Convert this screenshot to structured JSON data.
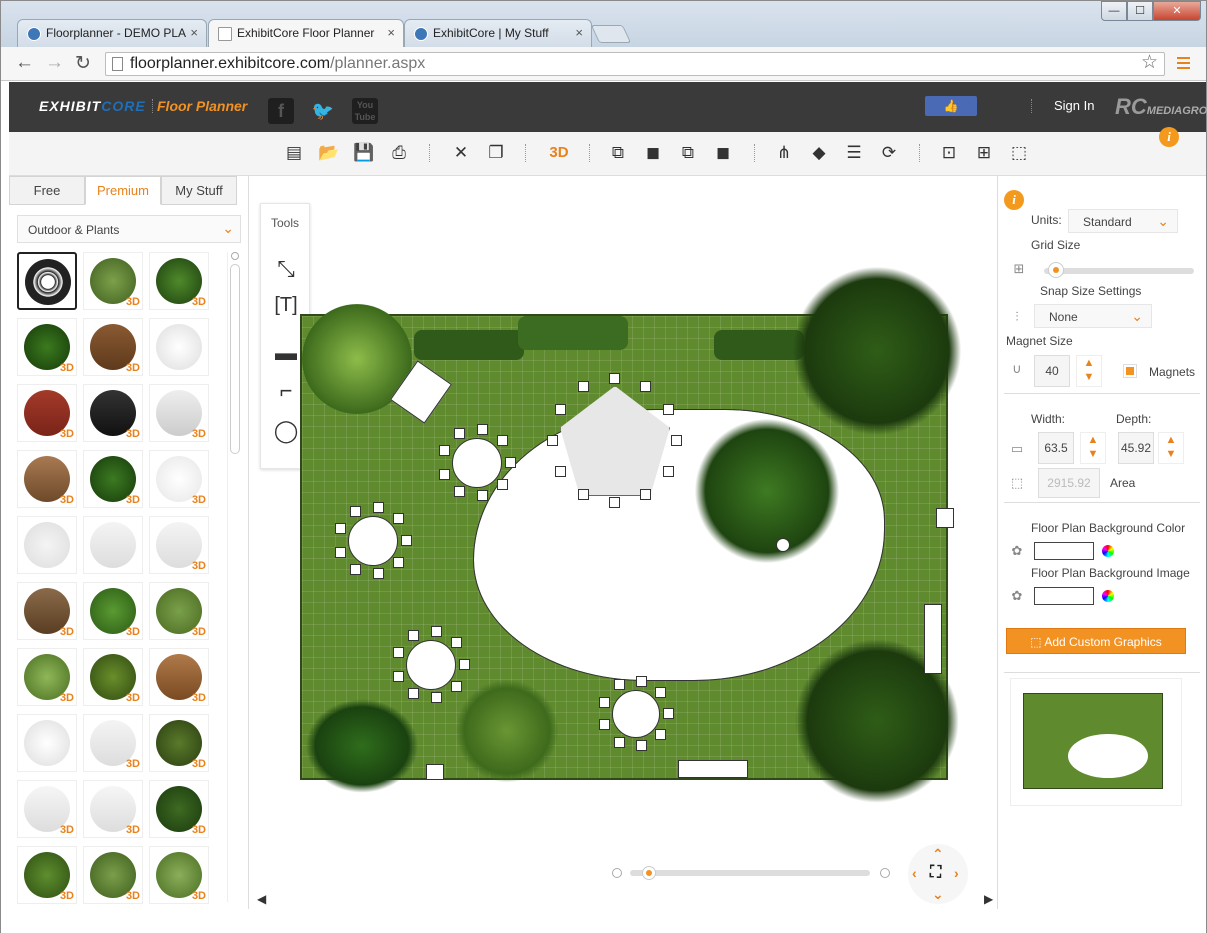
{
  "browser": {
    "tabs": [
      {
        "label": "Floorplanner - DEMO PLA",
        "close": "×"
      },
      {
        "label": "ExhibitCore Floor Planner",
        "close": "×"
      },
      {
        "label": "ExhibitCore | My Stuff",
        "close": "×"
      }
    ],
    "url_host": "floorplanner.exhibitcore.com",
    "url_path": "/planner.aspx",
    "window_controls": [
      "—",
      "☐",
      "✕"
    ]
  },
  "header": {
    "logo_exhibit": "EXHIBIT",
    "logo_core": "CORE",
    "product": "Floor Planner",
    "social": [
      "f",
      "🐦",
      "You Tube"
    ],
    "like": "👍",
    "signin": "Sign In",
    "partner_rc": "RC",
    "partner_name": "MEDIAGROUP"
  },
  "toolbar": {
    "threed": "3D"
  },
  "left": {
    "tabs": [
      "Free",
      "Premium",
      "My Stuff"
    ],
    "category": "Outdoor & Plants",
    "badge": "3D"
  },
  "canvas": {
    "tools_title": "Tools",
    "text_tool": "[T]"
  },
  "right": {
    "units_label": "Units:",
    "units_value": "Standard",
    "grid_size_label": "Grid Size",
    "snap_label": "Snap Size Settings",
    "snap_value": "None",
    "magnet_size_label": "Magnet Size",
    "magnet_value": "40",
    "magnets_label": "Magnets",
    "width_label": "Width:",
    "depth_label": "Depth:",
    "width_value": "63.5",
    "depth_value": "45.92",
    "area_value": "2915.92",
    "area_label": "Area",
    "bg_color_label": "Floor Plan Background Color",
    "bg_image_label": "Floor Plan Background Image",
    "add_custom": "Add Custom Graphics"
  },
  "colors": {
    "accent": "#f29222",
    "lawn": "#5f8a2e",
    "header_bg": "#3a3a3a",
    "brand_blue": "#1f6fb8"
  }
}
